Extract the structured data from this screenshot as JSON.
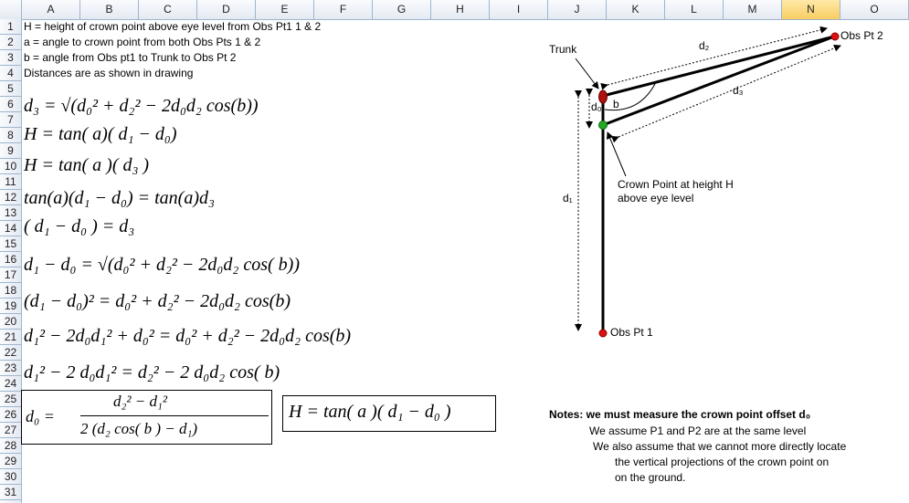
{
  "columns": [
    "A",
    "B",
    "C",
    "D",
    "E",
    "F",
    "G",
    "H",
    "I",
    "J",
    "K",
    "L",
    "M",
    "N",
    "O"
  ],
  "selected_column": "N",
  "rows": [
    "1",
    "2",
    "3",
    "4",
    "5",
    "6",
    "7",
    "8",
    "9",
    "10",
    "11",
    "12",
    "13",
    "14",
    "15",
    "16",
    "17",
    "18",
    "19",
    "20",
    "21",
    "22",
    "23",
    "24",
    "25",
    "26",
    "27",
    "28",
    "29",
    "30",
    "31"
  ],
  "cells": {
    "r1": "H = height of crown point above eye level from Obs Pt1 1 & 2",
    "r2": "a = angle to crown point from both Obs Pts 1 & 2",
    "r3": "b = angle from Obs pt1 to Trunk to Obs Pt 2",
    "r4": "Distances are as shown in drawing"
  },
  "equations": {
    "e1": "d₃ = √(d₀² + d₂² − 2d₀d₂ cos(b))",
    "e2": "H  =  tan(  a)( d₁ − d₀)",
    "e3": "H   =   tan(   a )( d₃ )",
    "e4": "tan(a)(d₁ − d₀) = tan(a)d₃",
    "e5": "( d₁  −  d₀ )  =  d₃",
    "e6": "d₁ − d₀ = √(d₀² + d₂² − 2d₀d₂ cos( b))",
    "e7": "(d₁ − d₀)² = d₀² + d₂² − 2d₀d₂ cos(b)",
    "e8": "d₁² − 2d₀d₁² + d₀² = d₀² + d₂² − 2d₀d₂ cos(b)",
    "e9": "d₁² − 2 d₀d₁²  =  d₂² − 2 d₀d₂ cos( b)",
    "e10_lhs": "d₀  =",
    "e10_num": "d₂²  −  d₁²",
    "e10_den": "2 (d₂ cos(   b )  −  d₁)",
    "e11": "H  =  tan(  a )( d₁ − d₀ )"
  },
  "diagram": {
    "trunk": "Trunk",
    "obs_pt2": "Obs Pt 2",
    "obs_pt1": "Obs Pt 1",
    "d2": "d₂",
    "d3": "d₃",
    "d1": "d₁",
    "d0": "d₀",
    "b": "b",
    "crown_line1": "Crown Point at height H",
    "crown_line2": "above eye level",
    "colors": {
      "trunk": "#b01010",
      "obs": "#e01010",
      "crown": "#22aa22",
      "selection": "#f8cd62",
      "grid": "#9eb6ce"
    }
  },
  "notes": {
    "title": "Notes: we must measure the crown point offset d₀",
    "line1": "We assume P1 and P2 are at the same level",
    "line2": "We also assume that we cannot more directly locate",
    "line3": "the vertical projections of the crown point on",
    "line4": "on the ground."
  }
}
